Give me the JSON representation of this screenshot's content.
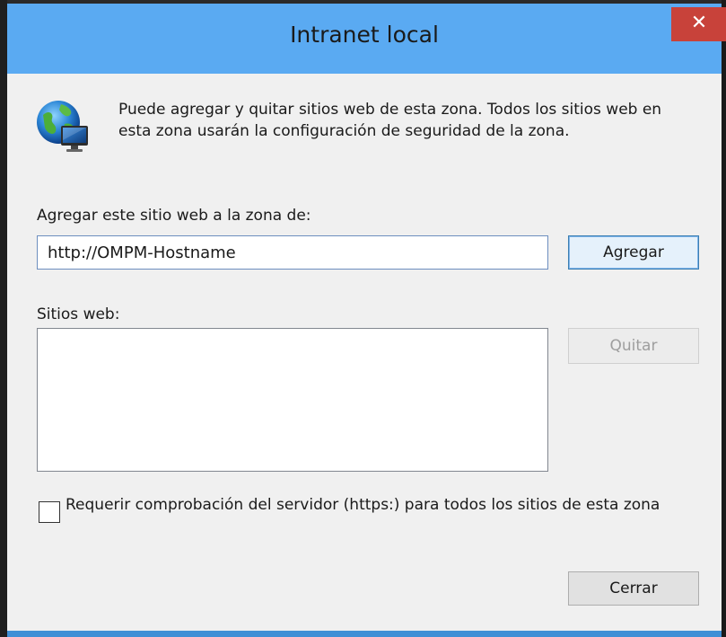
{
  "window": {
    "title": "Intranet local",
    "close_symbol": "✕"
  },
  "colors": {
    "title_bar": "#5aaaf2",
    "close_button": "#c8423a",
    "dialog_background": "#f0f0f0",
    "bottom_border": "#3f8fd6"
  },
  "header": {
    "icon": "globe-network-icon",
    "description": "Puede agregar y quitar sitios web de esta zona. Todos los sitios web en esta zona usarán la configuración de seguridad de la zona."
  },
  "add_section": {
    "label": "Agregar este sitio web a la zona de:",
    "input_value": "http://OMPM-Hostname",
    "add_button": "Agregar"
  },
  "sites_section": {
    "label": "Sitios web:",
    "items": [],
    "remove_button": "Quitar"
  },
  "https_option": {
    "label": "Requerir comprobación del servidor (https:) para todos los sitios de esta zona",
    "checked": false
  },
  "footer": {
    "close_button": "Cerrar"
  }
}
